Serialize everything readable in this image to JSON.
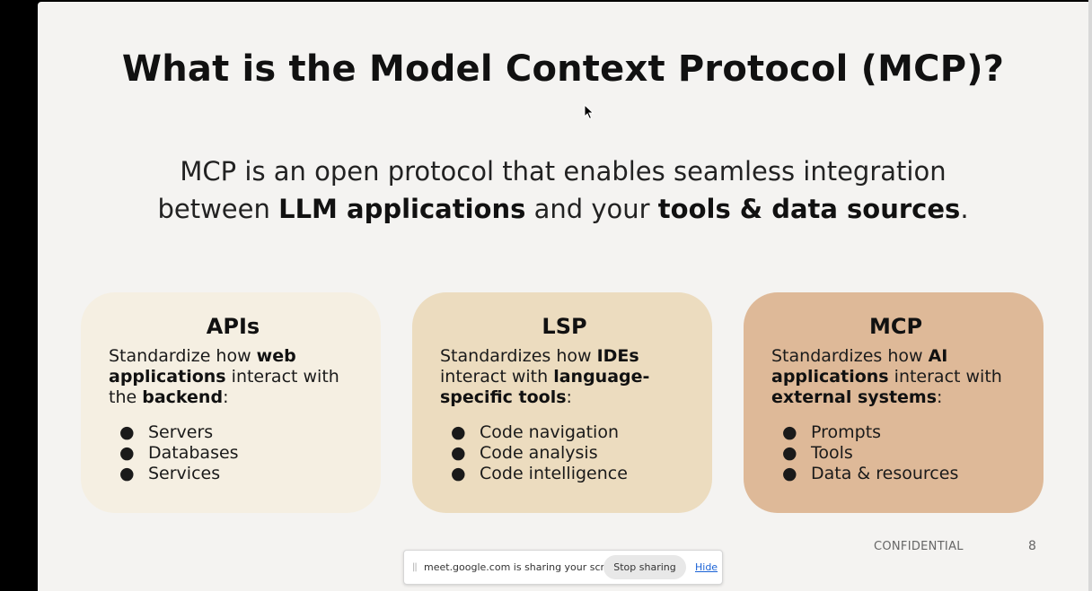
{
  "slide": {
    "title": "What is the Model Context Protocol (MCP)?",
    "subtitle": {
      "line1": "MCP is an open protocol that enables seamless integration",
      "line2_pre": "between ",
      "line2_b1": "LLM applications",
      "line2_mid": " and your ",
      "line2_b2": "tools & data sources",
      "line2_post": "."
    },
    "cards": [
      {
        "title": "APIs",
        "desc": [
          {
            "text": "Standardize how ",
            "bold": false
          },
          {
            "text": "web applications",
            "bold": true
          },
          {
            "text": " interact with the ",
            "bold": false
          },
          {
            "text": "backend",
            "bold": true
          },
          {
            "text": ":",
            "bold": false
          }
        ],
        "items": [
          "Servers",
          "Databases",
          "Services"
        ]
      },
      {
        "title": "LSP",
        "desc": [
          {
            "text": "Standardizes how ",
            "bold": false
          },
          {
            "text": "IDEs",
            "bold": true
          },
          {
            "text": " interact with ",
            "bold": false
          },
          {
            "text": "language-specific tools",
            "bold": true
          },
          {
            "text": ":",
            "bold": false
          }
        ],
        "items": [
          "Code navigation",
          "Code analysis",
          "Code intelligence"
        ]
      },
      {
        "title": "MCP",
        "desc": [
          {
            "text": "Standardizes how ",
            "bold": false
          },
          {
            "text": "AI applications",
            "bold": true
          },
          {
            "text": " interact with ",
            "bold": false
          },
          {
            "text": "external systems",
            "bold": true
          },
          {
            "text": ":",
            "bold": false
          }
        ],
        "items": [
          "Prompts",
          "Tools",
          "Data & resources"
        ]
      }
    ],
    "bullet": "●",
    "footer_label": "CONFIDENTIAL",
    "page_number": "8"
  },
  "share_bar": {
    "message": "meet.google.com is sharing your screen.",
    "stop_label": "Stop sharing",
    "hide_label": "Hide",
    "grip_glyph": "||"
  },
  "colors": {
    "card_apis": "#f5efe2",
    "card_lsp": "#ecdcbf",
    "card_mcp": "#deb998",
    "link": "#1a62d6"
  }
}
